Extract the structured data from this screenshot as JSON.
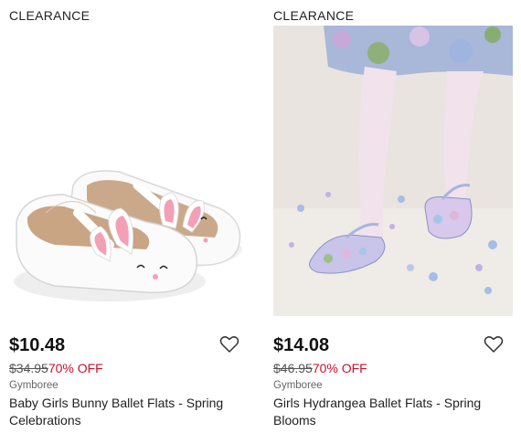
{
  "products": [
    {
      "badge": "CLEARANCE",
      "image_alt": "white patent bunny ballet flats",
      "price": "$10.48",
      "original_price": "$34.95",
      "discount": "70% OFF",
      "brand": "Gymboree",
      "title": "Baby Girls Bunny Ballet Flats - Spring Celebrations",
      "favorite_icon": "heart-outline-icon"
    },
    {
      "badge": "CLEARANCE",
      "image_alt": "girl wearing hydrangea print ballet flats with lace tights",
      "price": "$14.08",
      "original_price": "$46.95",
      "discount": "70% OFF",
      "brand": "Gymboree",
      "title": "Girls Hydrangea Ballet Flats - Spring Blooms",
      "favorite_icon": "heart-outline-icon"
    }
  ],
  "colors": {
    "discount": "#c8102e",
    "text": "#1a1a1a"
  }
}
